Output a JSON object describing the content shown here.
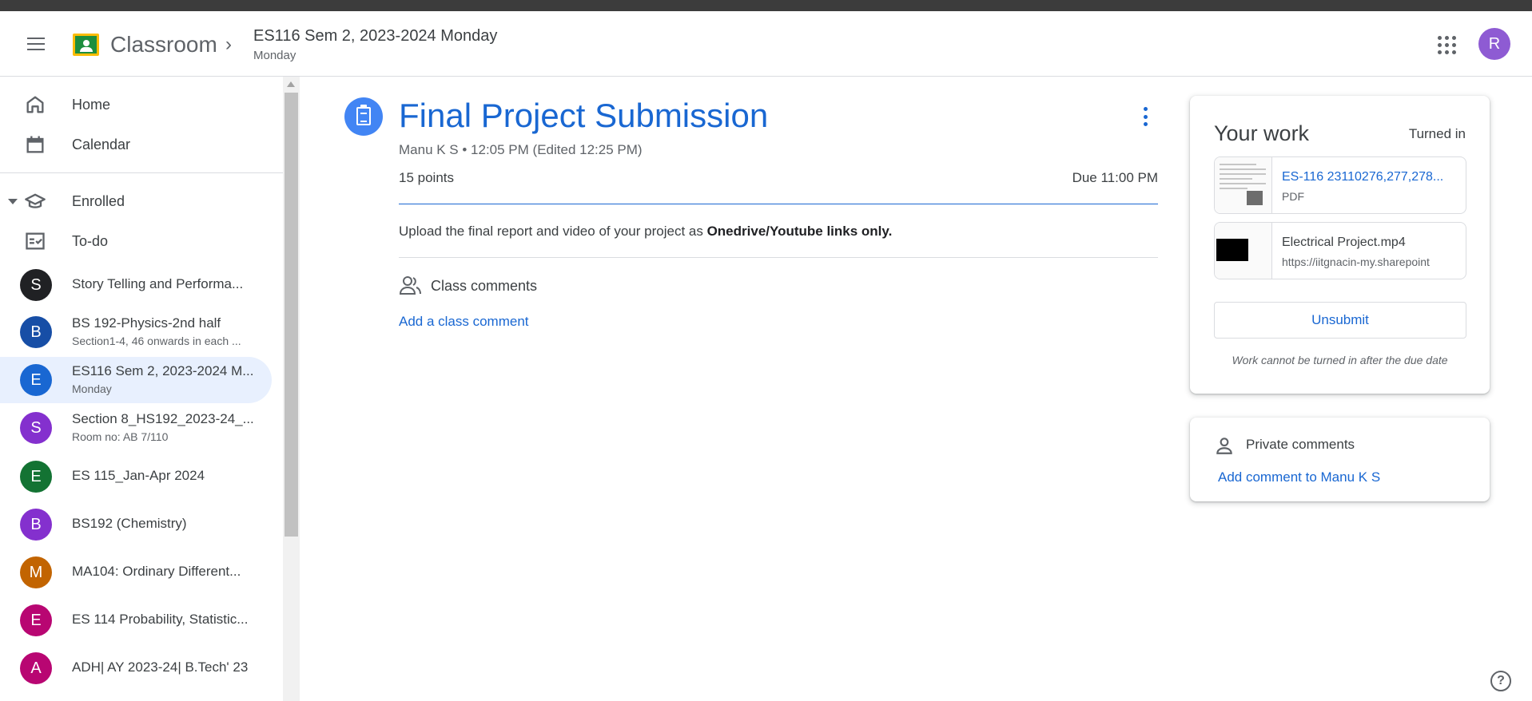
{
  "header": {
    "app_name": "Classroom",
    "breadcrumb_title": "ES116 Sem 2, 2023-2024 Monday",
    "breadcrumb_subtitle": "Monday",
    "user_initial": "R"
  },
  "sidebar": {
    "nav": [
      {
        "label": "Home",
        "icon": "home-icon"
      },
      {
        "label": "Calendar",
        "icon": "calendar-icon"
      }
    ],
    "enrolled_label": "Enrolled",
    "todo_label": "To-do",
    "courses": [
      {
        "initial": "S",
        "name": "Story Telling and Performa...",
        "subtitle": "",
        "color": "#202124"
      },
      {
        "initial": "B",
        "name": "BS 192-Physics-2nd half",
        "subtitle": "Section1-4, 46 onwards in each ...",
        "color": "#174ea6"
      },
      {
        "initial": "E",
        "name": "ES116 Sem 2, 2023-2024 M...",
        "subtitle": "Monday",
        "color": "#1967d2",
        "active": true
      },
      {
        "initial": "S",
        "name": "Section 8_HS192_2023-24_...",
        "subtitle": "Room no: AB 7/110",
        "color": "#8430ce"
      },
      {
        "initial": "E",
        "name": "ES 115_Jan-Apr 2024",
        "subtitle": "",
        "color": "#137333"
      },
      {
        "initial": "B",
        "name": "BS192 (Chemistry)",
        "subtitle": "",
        "color": "#8430ce"
      },
      {
        "initial": "M",
        "name": "MA104: Ordinary Different...",
        "subtitle": "",
        "color": "#c26401"
      },
      {
        "initial": "E",
        "name": "ES 114 Probability, Statistic...",
        "subtitle": "",
        "color": "#b80672"
      },
      {
        "initial": "A",
        "name": "ADH| AY 2023-24| B.Tech' 23",
        "subtitle": "",
        "color": "#b80672"
      }
    ]
  },
  "assignment": {
    "title": "Final Project Submission",
    "meta": "Manu K S • 12:05 PM (Edited 12:25 PM)",
    "points": "15 points",
    "due": "Due 11:00 PM",
    "description_prefix": "Upload the final report and video of your project as ",
    "description_bold": "Onedrive/Youtube links only.",
    "class_comments_label": "Class comments",
    "add_class_comment": "Add a class comment"
  },
  "your_work": {
    "title": "Your work",
    "status": "Turned in",
    "attachments": [
      {
        "name": "ES-116 23110276,277,278...",
        "type": "PDF"
      },
      {
        "name": "Electrical Project.mp4",
        "type": "https://iitgnacin-my.sharepoint"
      }
    ],
    "unsubmit_label": "Unsubmit",
    "note": "Work cannot be turned in after the due date"
  },
  "private_comments": {
    "label": "Private comments",
    "add": "Add comment to Manu K S"
  },
  "colors": {
    "accent": "#1967d2",
    "avatar": "#8e5bd3"
  }
}
